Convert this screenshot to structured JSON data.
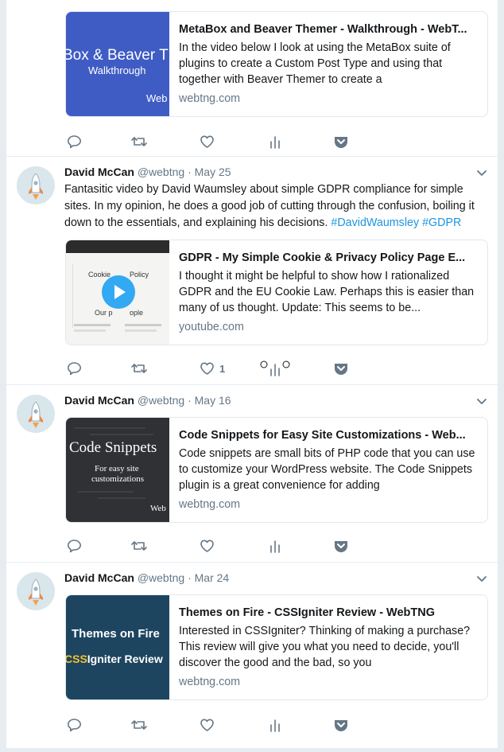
{
  "tweets": [
    {
      "card": {
        "title": "MetaBox and Beaver Themer - Walkthrough - WebT...",
        "description": "In the video below I look at using the MetaBox suite of plugins to create a Custom Post Type and using that together with Beaver Themer to create a",
        "domain": "webtng.com",
        "thumb_line1": "Box & Beaver Th",
        "thumb_line2": "Walkthrough",
        "thumb_line3": "Web"
      },
      "actions": {
        "reply": "reply-icon",
        "retweet": "retweet-icon",
        "like": "heart-icon",
        "like_count": "",
        "analytics": "analytics-icon",
        "pocket": "pocket-icon"
      }
    },
    {
      "author": {
        "name": "David McCan",
        "handle": "@webtng",
        "separator": "·",
        "date": "May 25"
      },
      "text": "Fantasitic video by David Waumsley about simple GDPR compliance for simple sites.  In my opinion, he does a good job of cutting through the confusion, boiling it down to the essentials, and explaining his decisions.",
      "hashtags": [
        "#DavidWaumsley",
        "#GDPR"
      ],
      "card": {
        "title": "GDPR - My Simple Cookie & Privacy Policy Page E...",
        "description": "I thought it might be helpful to show how I rationalized GDPR and the EU Cookie Law. Perhaps this is easier than many of us thought. Update: This seems to be...",
        "domain": "youtube.com",
        "thumb_line1": "Cookie",
        "thumb_line2": "Policy",
        "thumb_line3": "Our p",
        "thumb_line4": "ople"
      },
      "actions": {
        "reply": "reply-icon",
        "retweet": "retweet-icon",
        "like": "heart-icon",
        "like_count": "1",
        "analytics": "analytics-icon",
        "pocket": "pocket-icon"
      }
    },
    {
      "author": {
        "name": "David McCan",
        "handle": "@webtng",
        "separator": "·",
        "date": "May 16"
      },
      "card": {
        "title": "Code Snippets for Easy Site Customizations - Web...",
        "description": "Code snippets are small bits of PHP code that you can use to customize your WordPress website.  The Code Snippets plugin is a great convenience for adding",
        "domain": "webtng.com",
        "thumb_line1": "Code Snippets",
        "thumb_line2": "For easy site",
        "thumb_line3": "customizations",
        "thumb_line4": "Web"
      },
      "actions": {
        "reply": "reply-icon",
        "retweet": "retweet-icon",
        "like": "heart-icon",
        "like_count": "",
        "analytics": "analytics-icon",
        "pocket": "pocket-icon"
      }
    },
    {
      "author": {
        "name": "David McCan",
        "handle": "@webtng",
        "separator": "·",
        "date": "Mar 24"
      },
      "card": {
        "title": "Themes on Fire - CSSIgniter Review - WebTNG",
        "description": "Interested in CSSIgniter? Thinking of making a purchase? This review will give you what you need to decide, you'll discover the good and the bad, so you",
        "domain": "webtng.com",
        "thumb_line1": "Themes on Fire",
        "thumb_line2a": "CSS",
        "thumb_line2b": "Igniter Review"
      },
      "actions": {
        "reply": "reply-icon",
        "retweet": "retweet-icon",
        "like": "heart-icon",
        "like_count": "",
        "analytics": "analytics-icon",
        "pocket": "pocket-icon"
      }
    }
  ],
  "colors": {
    "link": "#1b95e0",
    "muted": "#657786",
    "icon": "#657786",
    "border": "#e1e8ed",
    "background": "#e6ecf0"
  }
}
